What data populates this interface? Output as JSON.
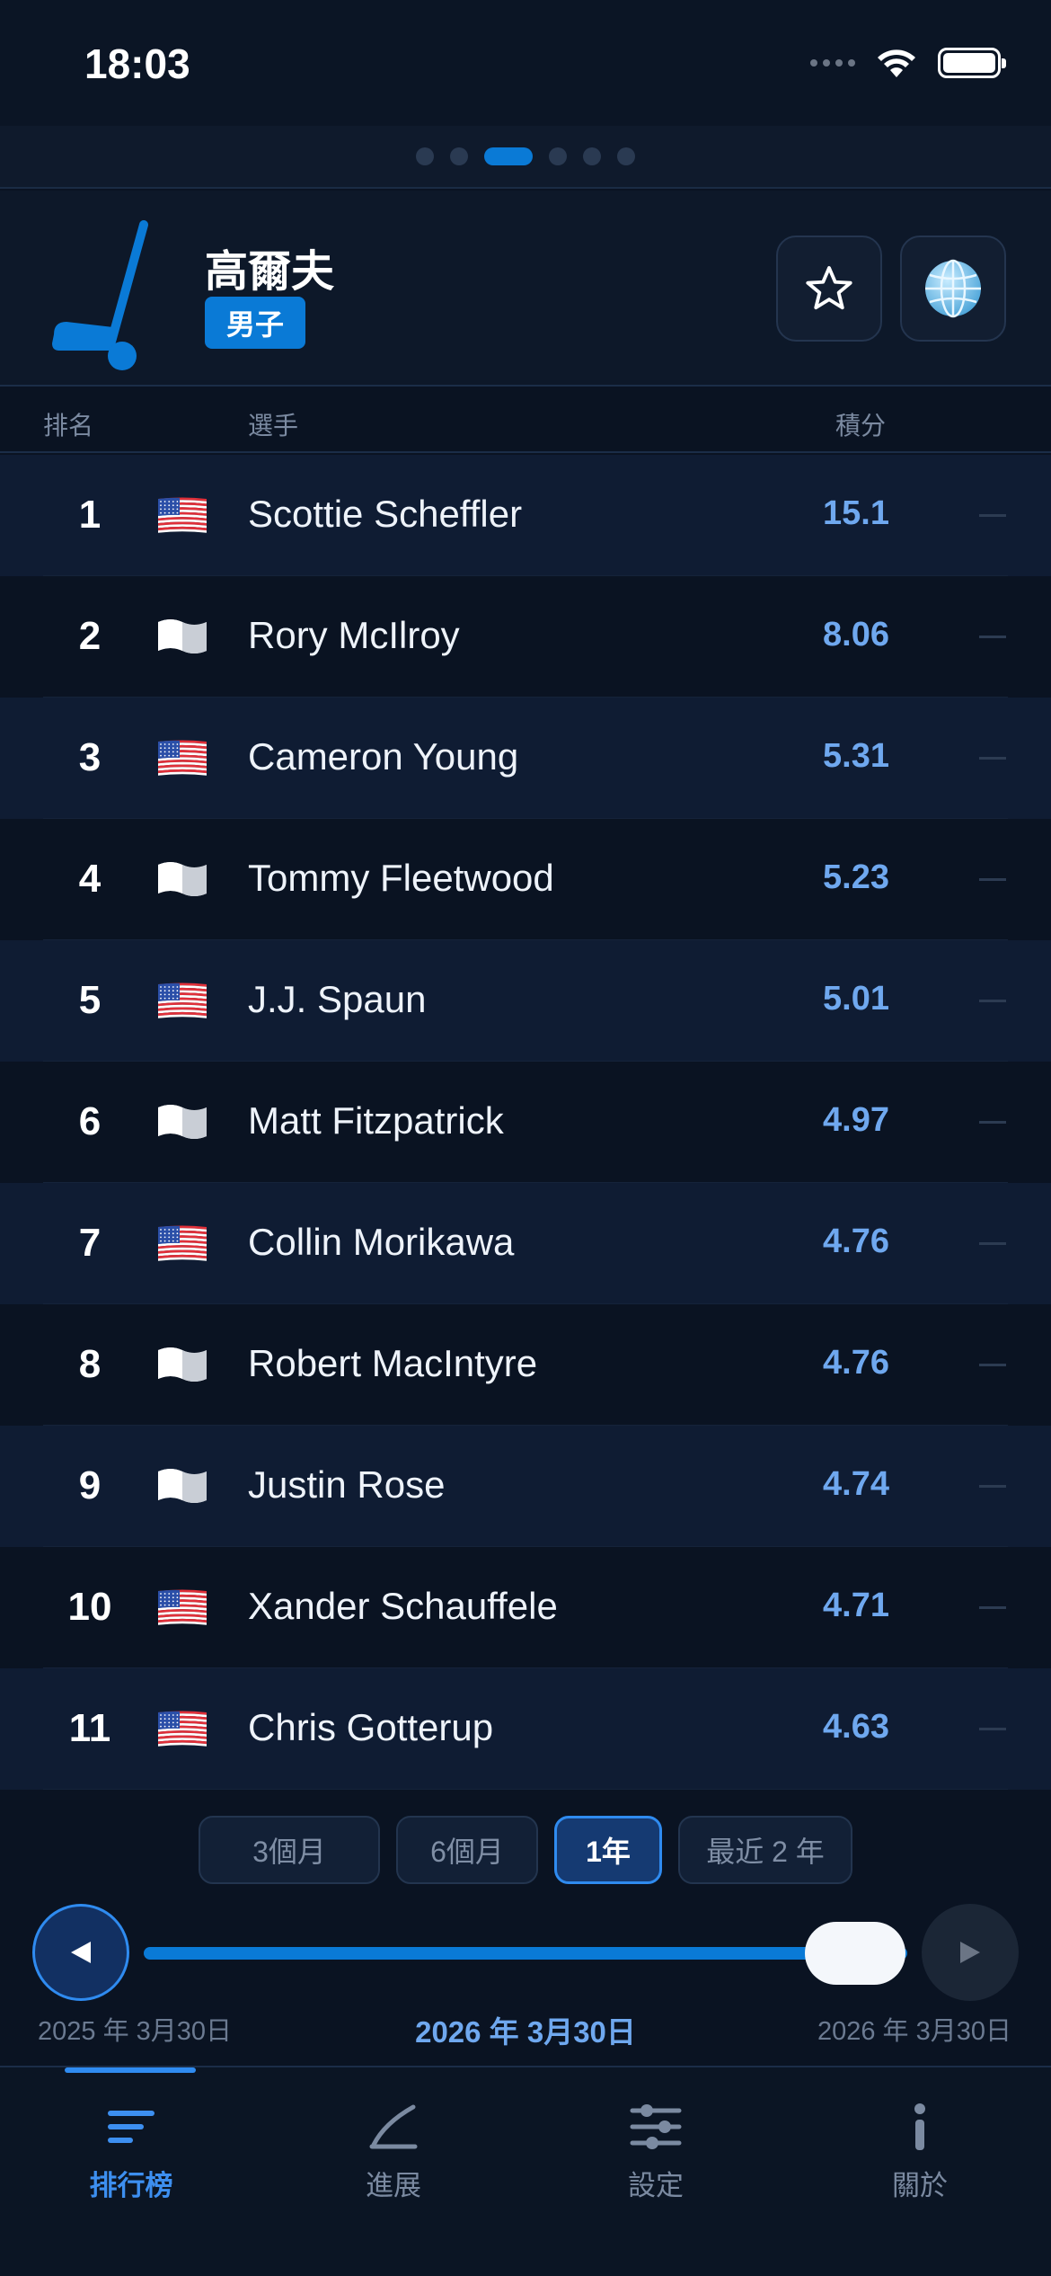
{
  "status": {
    "time": "18:03"
  },
  "pager": {
    "total": 6,
    "active_index": 2
  },
  "header": {
    "title": "高爾夫",
    "badge": "男子"
  },
  "columns": {
    "rank": "排名",
    "player": "選手",
    "points": "積分"
  },
  "players": [
    {
      "rank": "1",
      "name": "Scottie Scheffler",
      "points": "15.1",
      "flag": "us-flag-icon"
    },
    {
      "rank": "2",
      "name": "Rory McIlroy",
      "points": "8.06",
      "flag": "white-flag-icon"
    },
    {
      "rank": "3",
      "name": "Cameron Young",
      "points": "5.31",
      "flag": "us-flag-icon"
    },
    {
      "rank": "4",
      "name": "Tommy Fleetwood",
      "points": "5.23",
      "flag": "white-flag-icon"
    },
    {
      "rank": "5",
      "name": "J.J. Spaun",
      "points": "5.01",
      "flag": "us-flag-icon"
    },
    {
      "rank": "6",
      "name": "Matt Fitzpatrick",
      "points": "4.97",
      "flag": "white-flag-icon"
    },
    {
      "rank": "7",
      "name": "Collin Morikawa",
      "points": "4.76",
      "flag": "us-flag-icon"
    },
    {
      "rank": "8",
      "name": "Robert MacIntyre",
      "points": "4.76",
      "flag": "white-flag-icon"
    },
    {
      "rank": "9",
      "name": "Justin Rose",
      "points": "4.74",
      "flag": "white-flag-icon"
    },
    {
      "rank": "10",
      "name": "Xander Schauffele",
      "points": "4.71",
      "flag": "us-flag-icon"
    },
    {
      "rank": "11",
      "name": "Chris Gotterup",
      "points": "4.63",
      "flag": "us-flag-icon"
    }
  ],
  "range_tabs": [
    {
      "label": "3個月",
      "active": false
    },
    {
      "label": "6個月",
      "active": false
    },
    {
      "label": "1年",
      "active": true
    },
    {
      "label": "最近 2 年",
      "active": false
    }
  ],
  "timeline": {
    "start_label": "2025 年 3月30日",
    "current_label": "2026 年 3月30日",
    "end_label": "2026 年 3月30日",
    "position_fraction": 1.0
  },
  "tabs": [
    {
      "label": "排行榜",
      "icon": "list-icon",
      "active": true
    },
    {
      "label": "進展",
      "icon": "trend-line-icon",
      "active": false
    },
    {
      "label": "設定",
      "icon": "sliders-icon",
      "active": false
    },
    {
      "label": "關於",
      "icon": "info-icon",
      "active": false
    }
  ],
  "colors": {
    "accent": "#0a7ad6",
    "points": "#6fa8ef",
    "background": "#0a1322"
  }
}
